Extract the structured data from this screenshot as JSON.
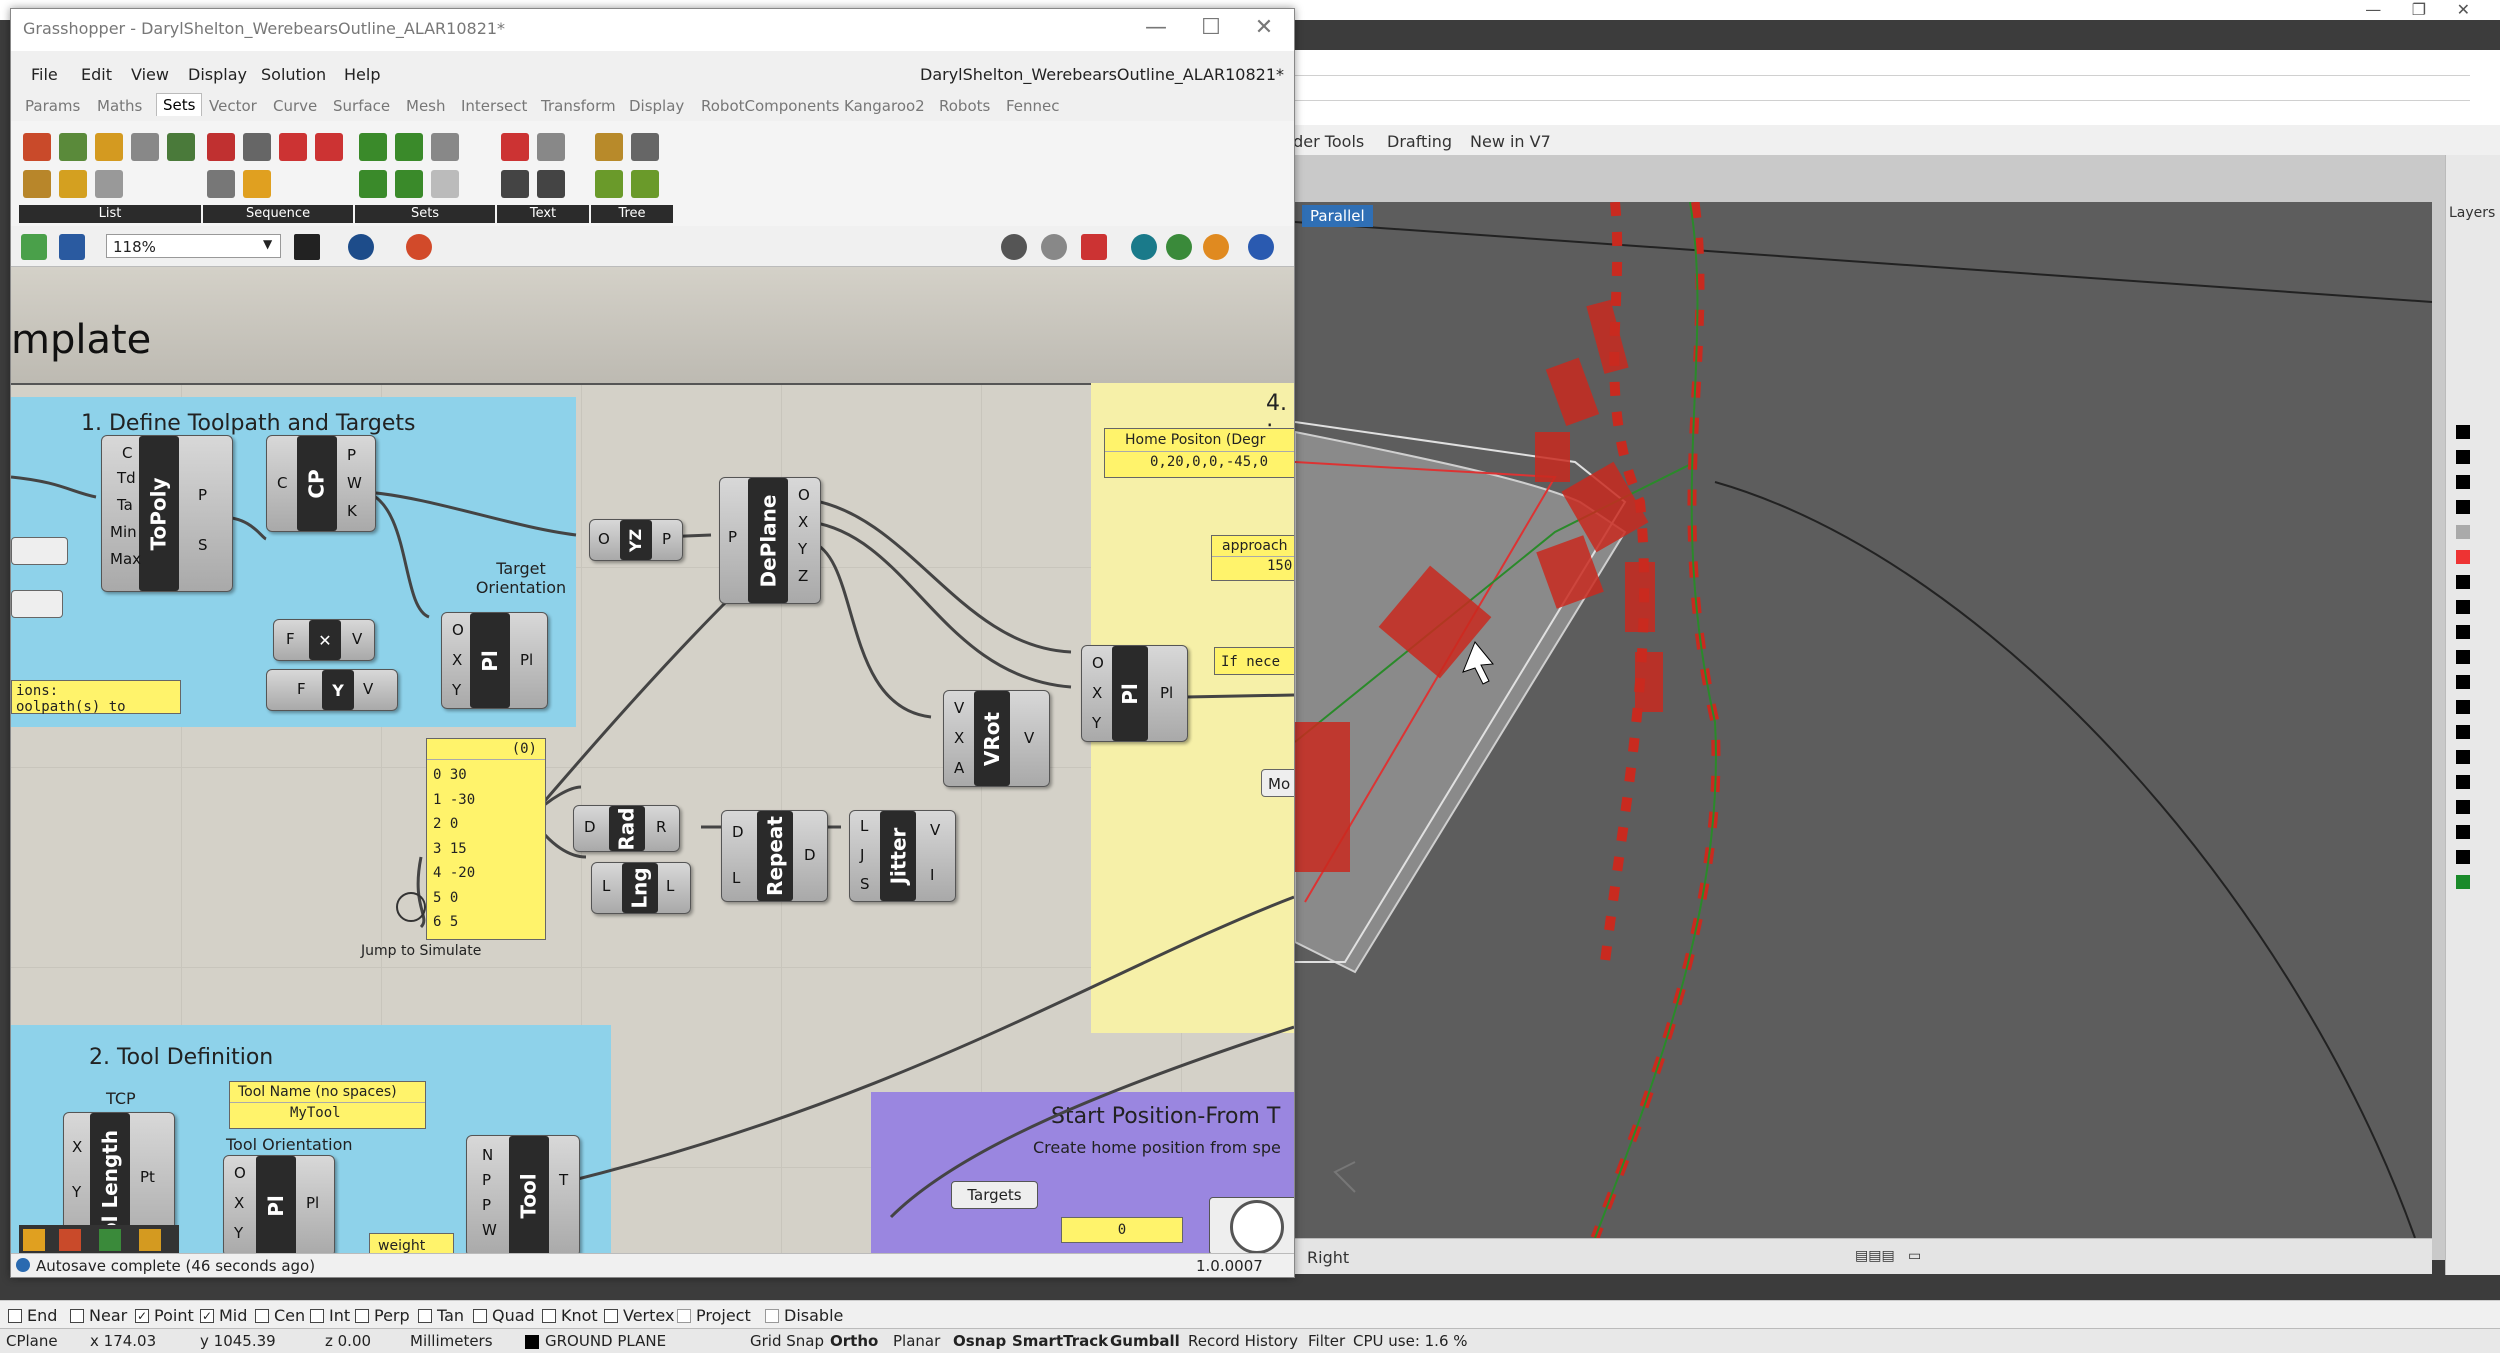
{
  "rhino": {
    "tabs": [
      "nder Tools",
      "Drafting",
      "New in V7"
    ],
    "viewport_label": "Parallel",
    "viewport_bottom": "Right",
    "layers_label": "Layers",
    "osnaps": [
      {
        "label": "End",
        "checked": false
      },
      {
        "label": "Near",
        "checked": false
      },
      {
        "label": "Point",
        "checked": true
      },
      {
        "label": "Mid",
        "checked": true
      },
      {
        "label": "Cen",
        "checked": false
      },
      {
        "label": "Int",
        "checked": false
      },
      {
        "label": "Perp",
        "checked": false
      },
      {
        "label": "Tan",
        "checked": false
      },
      {
        "label": "Quad",
        "checked": false
      },
      {
        "label": "Knot",
        "checked": false
      },
      {
        "label": "Vertex",
        "checked": false
      },
      {
        "label": "Project",
        "checked": false
      },
      {
        "label": "Disable",
        "checked": false
      }
    ],
    "status": {
      "cplane": "CPlane",
      "x": "x 174.03",
      "y": "y 1045.39",
      "z": "z 0.00",
      "units": "Millimeters",
      "layer": "GROUND PLANE",
      "grid_snap": "Grid Snap",
      "ortho": "Ortho",
      "planar": "Planar",
      "osnap": "Osnap",
      "smarttrack": "SmartTrack",
      "gumball": "Gumball",
      "record_history": "Record History",
      "filter": "Filter",
      "cpu": "CPU use: 1.6 %"
    }
  },
  "gh": {
    "title": "Grasshopper - DarylShelton_WerebearsOutline_ALAR10821*",
    "doc_name": "DarylShelton_WerebearsOutline_ALAR10821*",
    "menu": [
      "File",
      "Edit",
      "View",
      "Display",
      "Solution",
      "Help"
    ],
    "tabs": [
      "Params",
      "Maths",
      "Sets",
      "Vector",
      "Curve",
      "Surface",
      "Mesh",
      "Intersect",
      "Transform",
      "Display",
      "RobotComponents",
      "Kangaroo2",
      "Robots",
      "Fennec"
    ],
    "active_tab": "Sets",
    "ribbon_groups": [
      "List",
      "Sequence",
      "Sets",
      "Text",
      "Tree"
    ],
    "zoom": "118%",
    "canvas": {
      "template_title": "mplate",
      "group1_title": "1. Define Toolpath and Targets",
      "group2_title": "2. Tool Definition",
      "group4_title": "4. :",
      "start_title": "Start Position-From T",
      "start_subtitle": "Create home position from spe",
      "target_orientation": "Target Orientation",
      "tcp_label": "TCP",
      "tool_orientation": "Tool Orientation",
      "jump_label": "Jump to Simulate",
      "panel_header": "(0)",
      "list_values": [
        "0 30",
        "1 -30",
        "2 0",
        "3 15",
        "4 -20",
        "5 0",
        "6 5"
      ],
      "home_label": "Home Positon (Degr",
      "home_value": "0,20,0,0,-45,0",
      "approach_label": "approach",
      "approach_value": "150",
      "ifneed_value": "If nece",
      "tool_name_label": "Tool Name (no spaces)",
      "tool_name_value": "MyTool",
      "weight_label": "weight",
      "targets_label": "Targets",
      "zero_value": "0",
      "ions_text": "ions:",
      "toolpath_text": "oolpath(s) to",
      "mo_text": "Mo"
    },
    "components": {
      "topoly": "ToPoly",
      "cp": "CP",
      "yz": "YZ",
      "deplane": "DePlane",
      "pl1": "Pl",
      "pl2": "Pl",
      "pl3": "Pl",
      "vrot": "VRot",
      "rad": "Rad",
      "lng": "Lng",
      "repeat": "Repeat",
      "jitter": "Jitter",
      "length": "ol Length",
      "tool": "Tool"
    },
    "status": "Autosave complete (46 seconds ago)",
    "version": "1.0.0007"
  }
}
